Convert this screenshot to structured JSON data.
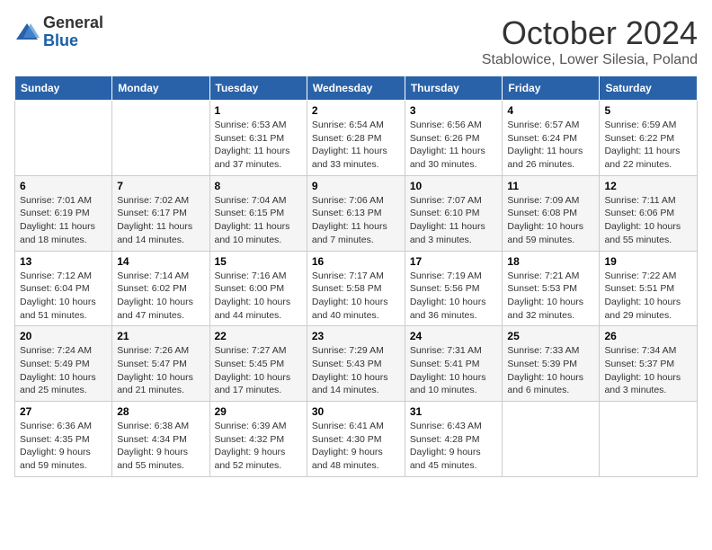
{
  "logo": {
    "general": "General",
    "blue": "Blue"
  },
  "title": "October 2024",
  "subtitle": "Stablowice, Lower Silesia, Poland",
  "days_of_week": [
    "Sunday",
    "Monday",
    "Tuesday",
    "Wednesday",
    "Thursday",
    "Friday",
    "Saturday"
  ],
  "weeks": [
    [
      {
        "day": "",
        "info": ""
      },
      {
        "day": "",
        "info": ""
      },
      {
        "day": "1",
        "info": "Sunrise: 6:53 AM\nSunset: 6:31 PM\nDaylight: 11 hours and 37 minutes."
      },
      {
        "day": "2",
        "info": "Sunrise: 6:54 AM\nSunset: 6:28 PM\nDaylight: 11 hours and 33 minutes."
      },
      {
        "day": "3",
        "info": "Sunrise: 6:56 AM\nSunset: 6:26 PM\nDaylight: 11 hours and 30 minutes."
      },
      {
        "day": "4",
        "info": "Sunrise: 6:57 AM\nSunset: 6:24 PM\nDaylight: 11 hours and 26 minutes."
      },
      {
        "day": "5",
        "info": "Sunrise: 6:59 AM\nSunset: 6:22 PM\nDaylight: 11 hours and 22 minutes."
      }
    ],
    [
      {
        "day": "6",
        "info": "Sunrise: 7:01 AM\nSunset: 6:19 PM\nDaylight: 11 hours and 18 minutes."
      },
      {
        "day": "7",
        "info": "Sunrise: 7:02 AM\nSunset: 6:17 PM\nDaylight: 11 hours and 14 minutes."
      },
      {
        "day": "8",
        "info": "Sunrise: 7:04 AM\nSunset: 6:15 PM\nDaylight: 11 hours and 10 minutes."
      },
      {
        "day": "9",
        "info": "Sunrise: 7:06 AM\nSunset: 6:13 PM\nDaylight: 11 hours and 7 minutes."
      },
      {
        "day": "10",
        "info": "Sunrise: 7:07 AM\nSunset: 6:10 PM\nDaylight: 11 hours and 3 minutes."
      },
      {
        "day": "11",
        "info": "Sunrise: 7:09 AM\nSunset: 6:08 PM\nDaylight: 10 hours and 59 minutes."
      },
      {
        "day": "12",
        "info": "Sunrise: 7:11 AM\nSunset: 6:06 PM\nDaylight: 10 hours and 55 minutes."
      }
    ],
    [
      {
        "day": "13",
        "info": "Sunrise: 7:12 AM\nSunset: 6:04 PM\nDaylight: 10 hours and 51 minutes."
      },
      {
        "day": "14",
        "info": "Sunrise: 7:14 AM\nSunset: 6:02 PM\nDaylight: 10 hours and 47 minutes."
      },
      {
        "day": "15",
        "info": "Sunrise: 7:16 AM\nSunset: 6:00 PM\nDaylight: 10 hours and 44 minutes."
      },
      {
        "day": "16",
        "info": "Sunrise: 7:17 AM\nSunset: 5:58 PM\nDaylight: 10 hours and 40 minutes."
      },
      {
        "day": "17",
        "info": "Sunrise: 7:19 AM\nSunset: 5:56 PM\nDaylight: 10 hours and 36 minutes."
      },
      {
        "day": "18",
        "info": "Sunrise: 7:21 AM\nSunset: 5:53 PM\nDaylight: 10 hours and 32 minutes."
      },
      {
        "day": "19",
        "info": "Sunrise: 7:22 AM\nSunset: 5:51 PM\nDaylight: 10 hours and 29 minutes."
      }
    ],
    [
      {
        "day": "20",
        "info": "Sunrise: 7:24 AM\nSunset: 5:49 PM\nDaylight: 10 hours and 25 minutes."
      },
      {
        "day": "21",
        "info": "Sunrise: 7:26 AM\nSunset: 5:47 PM\nDaylight: 10 hours and 21 minutes."
      },
      {
        "day": "22",
        "info": "Sunrise: 7:27 AM\nSunset: 5:45 PM\nDaylight: 10 hours and 17 minutes."
      },
      {
        "day": "23",
        "info": "Sunrise: 7:29 AM\nSunset: 5:43 PM\nDaylight: 10 hours and 14 minutes."
      },
      {
        "day": "24",
        "info": "Sunrise: 7:31 AM\nSunset: 5:41 PM\nDaylight: 10 hours and 10 minutes."
      },
      {
        "day": "25",
        "info": "Sunrise: 7:33 AM\nSunset: 5:39 PM\nDaylight: 10 hours and 6 minutes."
      },
      {
        "day": "26",
        "info": "Sunrise: 7:34 AM\nSunset: 5:37 PM\nDaylight: 10 hours and 3 minutes."
      }
    ],
    [
      {
        "day": "27",
        "info": "Sunrise: 6:36 AM\nSunset: 4:35 PM\nDaylight: 9 hours and 59 minutes."
      },
      {
        "day": "28",
        "info": "Sunrise: 6:38 AM\nSunset: 4:34 PM\nDaylight: 9 hours and 55 minutes."
      },
      {
        "day": "29",
        "info": "Sunrise: 6:39 AM\nSunset: 4:32 PM\nDaylight: 9 hours and 52 minutes."
      },
      {
        "day": "30",
        "info": "Sunrise: 6:41 AM\nSunset: 4:30 PM\nDaylight: 9 hours and 48 minutes."
      },
      {
        "day": "31",
        "info": "Sunrise: 6:43 AM\nSunset: 4:28 PM\nDaylight: 9 hours and 45 minutes."
      },
      {
        "day": "",
        "info": ""
      },
      {
        "day": "",
        "info": ""
      }
    ]
  ]
}
